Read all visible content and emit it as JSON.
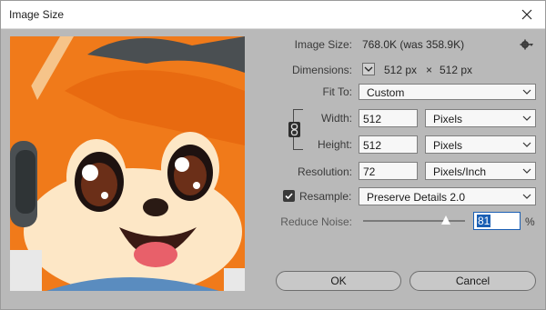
{
  "window": {
    "title": "Image Size"
  },
  "info": {
    "image_size_label": "Image Size:",
    "image_size_value": "768.0K (was 358.9K)",
    "dimensions_label": "Dimensions:",
    "dimensions_w": "512 px",
    "dimensions_x": "×",
    "dimensions_h": "512 px"
  },
  "fit_to": {
    "label": "Fit To:",
    "value": "Custom"
  },
  "width": {
    "label": "Width:",
    "value": "512",
    "unit": "Pixels"
  },
  "height": {
    "label": "Height:",
    "value": "512",
    "unit": "Pixels"
  },
  "resolution": {
    "label": "Resolution:",
    "value": "72",
    "unit": "Pixels/Inch"
  },
  "resample": {
    "label": "Resample:",
    "checked": true,
    "method": "Preserve Details 2.0"
  },
  "reduce_noise": {
    "label": "Reduce Noise:",
    "value": "81",
    "unit": "%",
    "level": 0.81
  },
  "buttons": {
    "ok": "OK",
    "cancel": "Cancel"
  },
  "colors": {
    "accent": "#1a5fb4",
    "panel": "#b9b9b9",
    "fox_orange": "#f07a1a"
  }
}
